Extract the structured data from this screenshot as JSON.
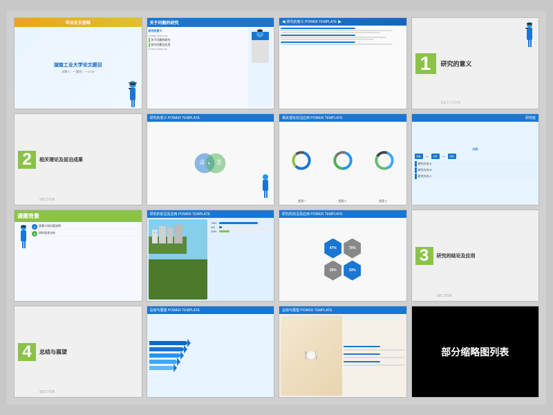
{
  "gallery": {
    "title": "部分缩略图列表",
    "background": "#c8c8c8",
    "rows": [
      {
        "slides": [
          {
            "id": "slide-1",
            "type": "title",
            "top_banner": "毕业论文答辩",
            "main_title": "湖南工业大学论文题目",
            "subtitle": "文章人：一 题目：一 2719",
            "has_grad_figure": true
          },
          {
            "id": "slide-2",
            "type": "content",
            "header": "关于问题的研究",
            "items": [
              "研究的意义",
              "POWER TEMPLATE",
              "关于问题的研究",
              "研究问题及应用",
              "POWER TEMPLATE"
            ]
          },
          {
            "id": "slide-3",
            "type": "content-text",
            "header": "研究的意义 POWER TEMPLATE",
            "has_table": true
          },
          {
            "id": "slide-4",
            "type": "section",
            "number": "1",
            "title": "研究的意义",
            "label": "SECTION",
            "has_grad_figure": true
          }
        ]
      },
      {
        "slides": [
          {
            "id": "slide-5",
            "type": "section",
            "number": "2",
            "title": "相关理论及前沿成果",
            "label": "SECTION"
          },
          {
            "id": "slide-6",
            "type": "venn",
            "header": "研究的意义 POWER TEMPLATE"
          },
          {
            "id": "slide-7",
            "type": "donut",
            "header": "相关理论前沿应用 POWER TEMPLATE"
          },
          {
            "id": "slide-8",
            "type": "analysis",
            "header": "研究班",
            "label": "分析"
          }
        ]
      },
      {
        "slides": [
          {
            "id": "slide-9",
            "type": "background",
            "header": "课题背景"
          },
          {
            "id": "slide-10",
            "type": "city",
            "header": "研究的前沿及应用 POWER TEMPLATE",
            "bars": [
              {
                "label": "75%",
                "width": "75",
                "color": "blue"
              },
              {
                "label": "5%",
                "width": "5",
                "color": "blue"
              },
              {
                "label": "20%",
                "width": "20",
                "color": "green"
              }
            ]
          },
          {
            "id": "slide-11",
            "type": "hexagon",
            "header": "研究的前沿及应用 POWER TEMPLATE",
            "values": [
              "47%",
              "20%",
              "75%",
              "33%"
            ]
          },
          {
            "id": "slide-12",
            "type": "section",
            "number": "3",
            "title": "研究的结论及应用",
            "label": "SECTION"
          }
        ]
      },
      {
        "slides": [
          {
            "id": "slide-13",
            "type": "section",
            "number": "4",
            "title": "总结与展望",
            "label": "SECTION"
          },
          {
            "id": "slide-14",
            "type": "arrows",
            "header": "总结与展望 POWER TEMPLATE"
          },
          {
            "id": "slide-15",
            "type": "food",
            "header": "总结与展望 POWER TEMPLATE"
          },
          {
            "id": "slide-16",
            "type": "label",
            "text": "部分缩略图列表"
          }
        ]
      }
    ]
  }
}
